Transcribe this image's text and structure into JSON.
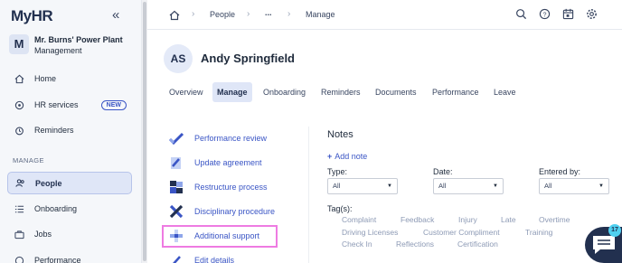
{
  "app": {
    "logo": "MyHR",
    "logo_swoosh": "~"
  },
  "org": {
    "initial": "M",
    "name": "Mr. Burns' Power Plant",
    "sub": "Management"
  },
  "sidebar": {
    "items": [
      {
        "label": "Home",
        "icon": "home-icon"
      },
      {
        "label": "HR services",
        "icon": "hr-services-icon",
        "badge": "NEW"
      },
      {
        "label": "Reminders",
        "icon": "alarm-icon"
      },
      {
        "label": "People",
        "icon": "people-icon"
      },
      {
        "label": "Onboarding",
        "icon": "checklist-icon"
      },
      {
        "label": "Jobs",
        "icon": "briefcase-icon"
      },
      {
        "label": "Performance",
        "icon": "performance-icon"
      }
    ],
    "section_label": "MANAGE"
  },
  "breadcrumb": {
    "items": [
      "People",
      "...",
      "Manage"
    ]
  },
  "profile": {
    "initials": "AS",
    "name": "Andy Springfield",
    "tabs": [
      "Overview",
      "Manage",
      "Onboarding",
      "Reminders",
      "Documents",
      "Performance",
      "Leave"
    ],
    "active_tab": "Manage"
  },
  "actions": [
    "Performance review",
    "Update agreement",
    "Restructure process",
    "Disciplinary procedure",
    "Additional support",
    "Edit details"
  ],
  "notes": {
    "title": "Notes",
    "add_note": "Add note",
    "filters": [
      {
        "label": "Type:",
        "value": "All"
      },
      {
        "label": "Date:",
        "value": "All"
      },
      {
        "label": "Entered by:",
        "value": "All"
      }
    ],
    "tags_label": "Tag(s):",
    "tags": [
      "Complaint",
      "Feedback",
      "Injury",
      "Late",
      "Overtime",
      "Driving Licenses",
      "Customer Compliment",
      "Training",
      "Check In",
      "Reflections",
      "Certification"
    ]
  },
  "chat": {
    "badge": "17"
  },
  "colors": {
    "accent": "#3a55c5",
    "navy": "#22304f",
    "highlight": "#ee7be2"
  }
}
